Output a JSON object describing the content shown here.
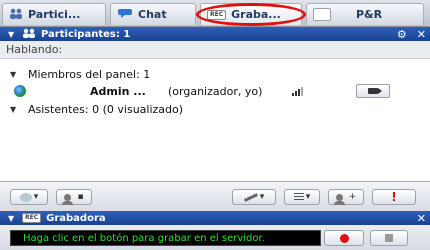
{
  "tabs": [
    {
      "label": "Partici...",
      "icon": "participants-icon"
    },
    {
      "label": "Chat",
      "icon": "chat-icon"
    },
    {
      "label": "Graba...",
      "icon": "rec-icon",
      "badge": "REC"
    },
    {
      "label": "P&R",
      "icon": "qa-icon"
    }
  ],
  "participants_panel": {
    "title": "Participantes: 1",
    "speaking_label": "Hablando:",
    "panelists_label": "Miembros del panel: 1",
    "admin_name": "Admin ...",
    "admin_role": "(organizador, yo)",
    "attendees_label": "Asistentes: 0 (0 visualizado)"
  },
  "recorder_panel": {
    "title": "Grabadora",
    "badge": "REC",
    "status_message": "Haga clic en el botón para grabar en el servidor."
  },
  "colors": {
    "header_blue": "#1b4290",
    "highlight_ellipse": "#e01010",
    "status_text_green": "#2ee02e",
    "alert_red": "#e01010"
  }
}
